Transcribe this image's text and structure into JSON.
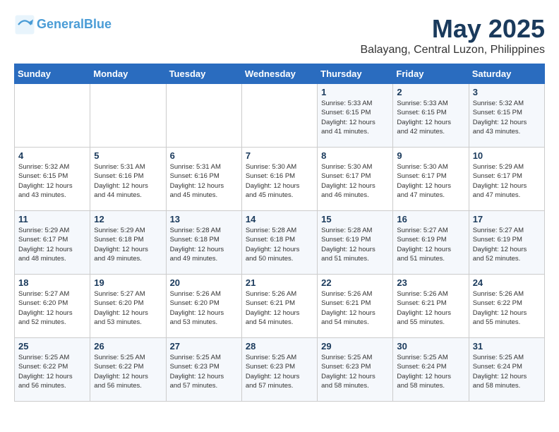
{
  "logo": {
    "line1": "General",
    "line2": "Blue"
  },
  "title": "May 2025",
  "location": "Balayang, Central Luzon, Philippines",
  "days_of_week": [
    "Sunday",
    "Monday",
    "Tuesday",
    "Wednesday",
    "Thursday",
    "Friday",
    "Saturday"
  ],
  "weeks": [
    [
      {
        "day": "",
        "info": ""
      },
      {
        "day": "",
        "info": ""
      },
      {
        "day": "",
        "info": ""
      },
      {
        "day": "",
        "info": ""
      },
      {
        "day": "1",
        "info": "Sunrise: 5:33 AM\nSunset: 6:15 PM\nDaylight: 12 hours\nand 41 minutes."
      },
      {
        "day": "2",
        "info": "Sunrise: 5:33 AM\nSunset: 6:15 PM\nDaylight: 12 hours\nand 42 minutes."
      },
      {
        "day": "3",
        "info": "Sunrise: 5:32 AM\nSunset: 6:15 PM\nDaylight: 12 hours\nand 43 minutes."
      }
    ],
    [
      {
        "day": "4",
        "info": "Sunrise: 5:32 AM\nSunset: 6:15 PM\nDaylight: 12 hours\nand 43 minutes."
      },
      {
        "day": "5",
        "info": "Sunrise: 5:31 AM\nSunset: 6:16 PM\nDaylight: 12 hours\nand 44 minutes."
      },
      {
        "day": "6",
        "info": "Sunrise: 5:31 AM\nSunset: 6:16 PM\nDaylight: 12 hours\nand 45 minutes."
      },
      {
        "day": "7",
        "info": "Sunrise: 5:30 AM\nSunset: 6:16 PM\nDaylight: 12 hours\nand 45 minutes."
      },
      {
        "day": "8",
        "info": "Sunrise: 5:30 AM\nSunset: 6:17 PM\nDaylight: 12 hours\nand 46 minutes."
      },
      {
        "day": "9",
        "info": "Sunrise: 5:30 AM\nSunset: 6:17 PM\nDaylight: 12 hours\nand 47 minutes."
      },
      {
        "day": "10",
        "info": "Sunrise: 5:29 AM\nSunset: 6:17 PM\nDaylight: 12 hours\nand 47 minutes."
      }
    ],
    [
      {
        "day": "11",
        "info": "Sunrise: 5:29 AM\nSunset: 6:17 PM\nDaylight: 12 hours\nand 48 minutes."
      },
      {
        "day": "12",
        "info": "Sunrise: 5:29 AM\nSunset: 6:18 PM\nDaylight: 12 hours\nand 49 minutes."
      },
      {
        "day": "13",
        "info": "Sunrise: 5:28 AM\nSunset: 6:18 PM\nDaylight: 12 hours\nand 49 minutes."
      },
      {
        "day": "14",
        "info": "Sunrise: 5:28 AM\nSunset: 6:18 PM\nDaylight: 12 hours\nand 50 minutes."
      },
      {
        "day": "15",
        "info": "Sunrise: 5:28 AM\nSunset: 6:19 PM\nDaylight: 12 hours\nand 51 minutes."
      },
      {
        "day": "16",
        "info": "Sunrise: 5:27 AM\nSunset: 6:19 PM\nDaylight: 12 hours\nand 51 minutes."
      },
      {
        "day": "17",
        "info": "Sunrise: 5:27 AM\nSunset: 6:19 PM\nDaylight: 12 hours\nand 52 minutes."
      }
    ],
    [
      {
        "day": "18",
        "info": "Sunrise: 5:27 AM\nSunset: 6:20 PM\nDaylight: 12 hours\nand 52 minutes."
      },
      {
        "day": "19",
        "info": "Sunrise: 5:27 AM\nSunset: 6:20 PM\nDaylight: 12 hours\nand 53 minutes."
      },
      {
        "day": "20",
        "info": "Sunrise: 5:26 AM\nSunset: 6:20 PM\nDaylight: 12 hours\nand 53 minutes."
      },
      {
        "day": "21",
        "info": "Sunrise: 5:26 AM\nSunset: 6:21 PM\nDaylight: 12 hours\nand 54 minutes."
      },
      {
        "day": "22",
        "info": "Sunrise: 5:26 AM\nSunset: 6:21 PM\nDaylight: 12 hours\nand 54 minutes."
      },
      {
        "day": "23",
        "info": "Sunrise: 5:26 AM\nSunset: 6:21 PM\nDaylight: 12 hours\nand 55 minutes."
      },
      {
        "day": "24",
        "info": "Sunrise: 5:26 AM\nSunset: 6:22 PM\nDaylight: 12 hours\nand 55 minutes."
      }
    ],
    [
      {
        "day": "25",
        "info": "Sunrise: 5:25 AM\nSunset: 6:22 PM\nDaylight: 12 hours\nand 56 minutes."
      },
      {
        "day": "26",
        "info": "Sunrise: 5:25 AM\nSunset: 6:22 PM\nDaylight: 12 hours\nand 56 minutes."
      },
      {
        "day": "27",
        "info": "Sunrise: 5:25 AM\nSunset: 6:23 PM\nDaylight: 12 hours\nand 57 minutes."
      },
      {
        "day": "28",
        "info": "Sunrise: 5:25 AM\nSunset: 6:23 PM\nDaylight: 12 hours\nand 57 minutes."
      },
      {
        "day": "29",
        "info": "Sunrise: 5:25 AM\nSunset: 6:23 PM\nDaylight: 12 hours\nand 58 minutes."
      },
      {
        "day": "30",
        "info": "Sunrise: 5:25 AM\nSunset: 6:24 PM\nDaylight: 12 hours\nand 58 minutes."
      },
      {
        "day": "31",
        "info": "Sunrise: 5:25 AM\nSunset: 6:24 PM\nDaylight: 12 hours\nand 58 minutes."
      }
    ]
  ]
}
